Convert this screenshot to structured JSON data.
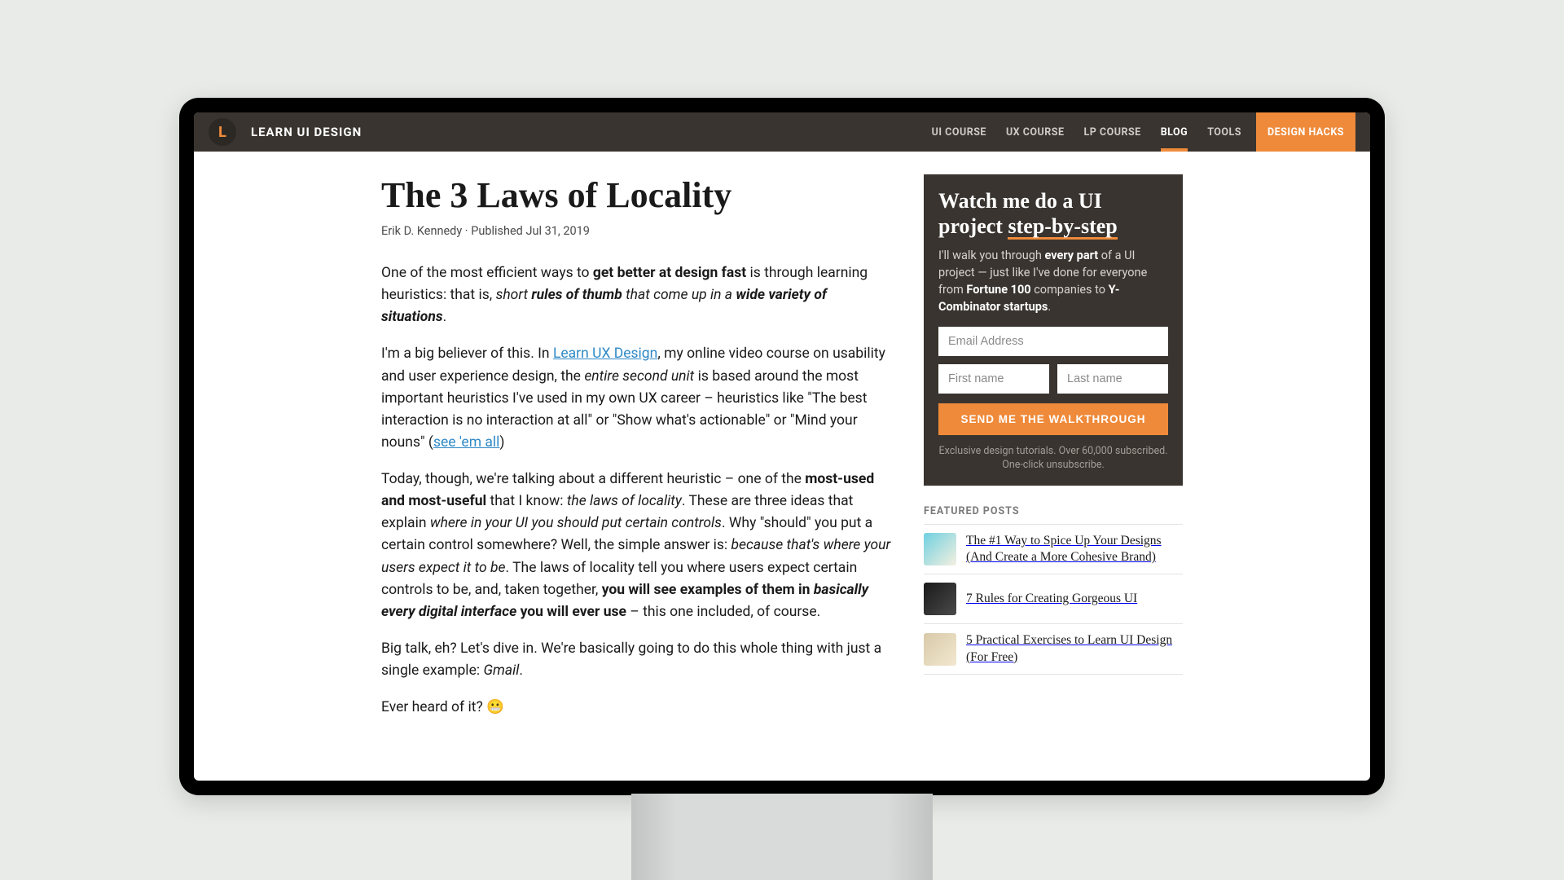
{
  "header": {
    "logo_letter": "L",
    "brand": "LEARN UI DESIGN",
    "nav": [
      {
        "label": "UI COURSE",
        "active": false,
        "cta": false
      },
      {
        "label": "UX COURSE",
        "active": false,
        "cta": false
      },
      {
        "label": "LP COURSE",
        "active": false,
        "cta": false
      },
      {
        "label": "BLOG",
        "active": true,
        "cta": false
      },
      {
        "label": "TOOLS",
        "active": false,
        "cta": false
      },
      {
        "label": "DESIGN HACKS",
        "active": false,
        "cta": true
      }
    ]
  },
  "article": {
    "title": "The 3 Laws of Locality",
    "author": "Erik D. Kennedy",
    "published_prefix": "Published ",
    "published_date": "Jul 31, 2019",
    "p1_a": "One of the most efficient ways to ",
    "p1_b_strong": "get better at design fast",
    "p1_c": " is through learning heuristics: that is, ",
    "p1_d_em": "short ",
    "p1_e_strongem": "rules of thumb",
    "p1_f_em": " that come up in a ",
    "p1_g_strongem": "wide variety of situations",
    "p1_h": ".",
    "p2_a": "I'm a big believer of this. In ",
    "p2_link1": "Learn UX Design",
    "p2_b": ", my online video course on usability and user experience design, the ",
    "p2_c_em": "entire second unit",
    "p2_d": " is based around the most important heuristics I've used in my own UX career – heuristics like \"The best interaction is no interaction at all\" or \"Show what's actionable\" or \"Mind your nouns\" (",
    "p2_link2": "see 'em all",
    "p2_e": ")",
    "p3_a": "Today, though, we're talking about a different heuristic – one of the ",
    "p3_b_strong": "most-used and most-useful",
    "p3_c": " that I know: ",
    "p3_d_em": "the laws of locality",
    "p3_e": ". These are three ideas that explain ",
    "p3_f_em": "where in your UI you should put certain controls",
    "p3_g": ". Why \"should\" you put a certain control somewhere? Well, the simple answer is: ",
    "p3_h_em": "because that's where your users expect it to be",
    "p3_i": ". The laws of locality tell you where users expect certain controls to be, and, taken together, ",
    "p3_j_strong": "you will see examples of them in ",
    "p3_k_strongem": "basically every digital interface",
    "p3_l_strong": " you will ever use",
    "p3_m": " – this one included, of course.",
    "p4_a": "Big talk, eh? Let's dive in. We're basically going to do this whole thing with just a single example: ",
    "p4_b_em": "Gmail",
    "p4_c": ".",
    "p5": "Ever heard of it? 😬"
  },
  "sidebar": {
    "optin": {
      "heading_a": "Watch me do a UI project ",
      "heading_b_underline": "step-by-step",
      "lead_a": "I'll walk you through ",
      "lead_b_strong": "every part",
      "lead_c": " of a UI project — just like I've done for everyone from ",
      "lead_d_strong": "Fortune 100",
      "lead_e": " companies to ",
      "lead_f_strong": "Y-Combinator startups",
      "lead_g": ".",
      "email_placeholder": "Email Address",
      "first_placeholder": "First name",
      "last_placeholder": "Last name",
      "button": "SEND ME THE WALKTHROUGH",
      "fine": "Exclusive design tutorials. Over 60,000 subscribed. One-click unsubscribe."
    },
    "featured_label": "FEATURED POSTS",
    "posts": [
      {
        "title": "The #1 Way to Spice Up Your Designs (And Create a More Cohesive Brand)"
      },
      {
        "title": "7 Rules for Creating Gorgeous UI"
      },
      {
        "title": "5 Practical Exercises to Learn UI Design (For Free)"
      }
    ]
  }
}
